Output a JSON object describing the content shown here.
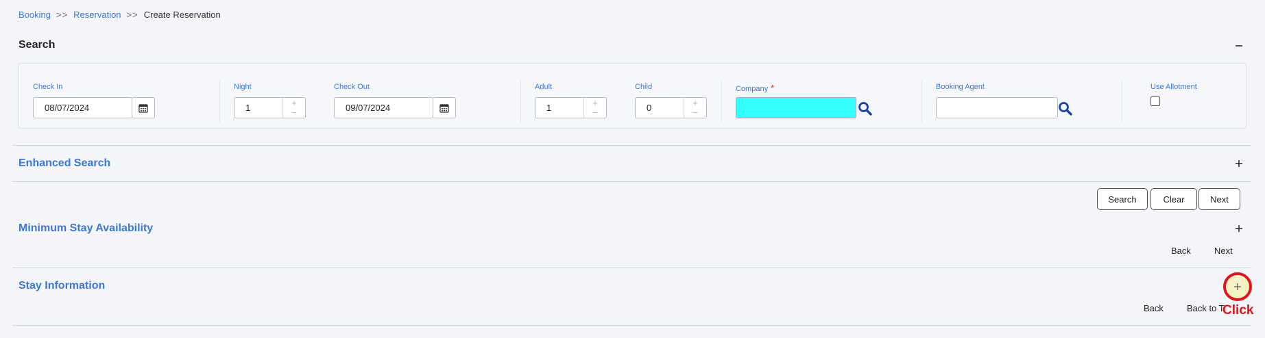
{
  "breadcrumb": {
    "items": [
      "Booking",
      "Reservation",
      "Create Reservation"
    ],
    "separator": ">>"
  },
  "search": {
    "title": "Search",
    "collapse_icon": "minus-icon",
    "check_in": {
      "label": "Check In",
      "value": "08/07/2024"
    },
    "night": {
      "label": "Night",
      "value": "1"
    },
    "check_out": {
      "label": "Check Out",
      "value": "09/07/2024"
    },
    "adult": {
      "label": "Adult",
      "value": "1"
    },
    "child": {
      "label": "Child",
      "value": "0"
    },
    "company": {
      "label": "Company",
      "required_mark": "*",
      "value": ""
    },
    "booking_agent": {
      "label": "Booking Agent",
      "value": ""
    },
    "use_allotment": {
      "label": "Use Allotment",
      "checked": false
    }
  },
  "enhanced_search": {
    "title": "Enhanced Search",
    "toggle_icon": "plus-icon"
  },
  "actions": {
    "search_label": "Search",
    "clear_label": "Clear",
    "next_label": "Next"
  },
  "min_stay": {
    "title": "Minimum Stay Availability",
    "toggle_icon": "plus-icon",
    "back_label": "Back",
    "next_label": "Next"
  },
  "stay_info": {
    "title": "Stay Information",
    "toggle_icon": "plus-icon",
    "back_label": "Back",
    "back_to_label": "Back to T"
  },
  "annotation": {
    "text": "Click",
    "color": "#e0141e"
  },
  "colors": {
    "accent": "#3f77d4",
    "company_field": "#33ffff",
    "required": "#d9251c"
  }
}
